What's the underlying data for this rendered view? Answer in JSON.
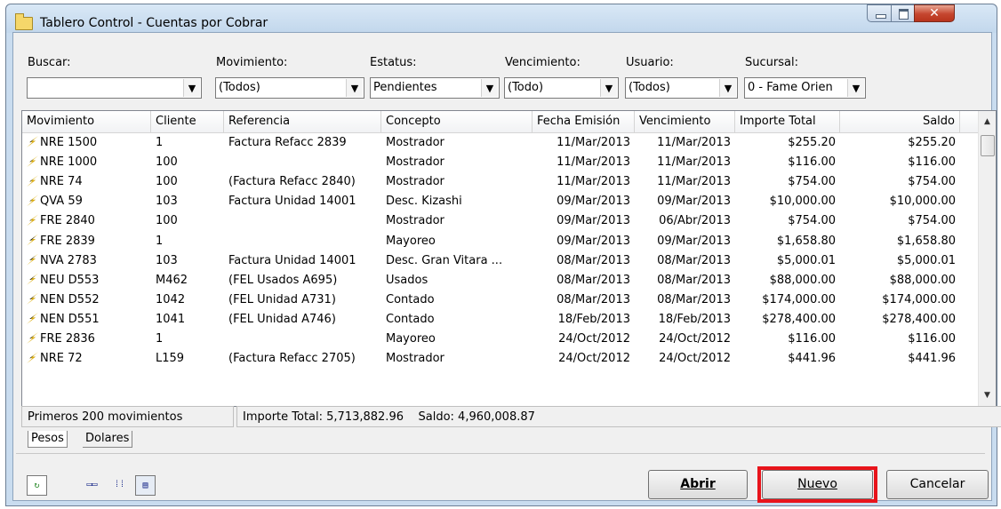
{
  "window": {
    "title": "Tablero Control - Cuentas por Cobrar"
  },
  "filters": {
    "buscar": {
      "label": "Buscar:",
      "value": ""
    },
    "movimiento": {
      "label": "Movimiento:",
      "value": "(Todos)"
    },
    "estatus": {
      "label": "Estatus:",
      "value": "Pendientes"
    },
    "vencimiento": {
      "label": "Vencimiento:",
      "value": "(Todo)"
    },
    "usuario": {
      "label": "Usuario:",
      "value": "(Todos)"
    },
    "sucursal": {
      "label": "Sucursal:",
      "value": "0 - Fame Orien"
    }
  },
  "grid": {
    "columns": [
      "Movimiento",
      "Cliente",
      "Referencia",
      "Concepto",
      "Fecha Emisión",
      "Vencimiento",
      "Importe Total",
      "Saldo"
    ],
    "rows": [
      [
        "NRE 1500",
        "1",
        "Factura Refacc 2839",
        "Mostrador",
        "11/Mar/2013",
        "11/Mar/2013",
        "$255.20",
        "$255.20"
      ],
      [
        "NRE 1000",
        "100",
        "",
        "Mostrador",
        "11/Mar/2013",
        "11/Mar/2013",
        "$116.00",
        "$116.00"
      ],
      [
        "NRE 74",
        "100",
        "(Factura Refacc 2840)",
        "Mostrador",
        "11/Mar/2013",
        "11/Mar/2013",
        "$754.00",
        "$754.00"
      ],
      [
        "QVA 59",
        "103",
        "Factura Unidad 14001",
        "Desc. Kizashi",
        "09/Mar/2013",
        "09/Mar/2013",
        "$10,000.00",
        "$10,000.00"
      ],
      [
        "FRE 2840",
        "100",
        "",
        "Mostrador",
        "09/Mar/2013",
        "06/Abr/2013",
        "$754.00",
        "$754.00"
      ],
      [
        "FRE 2839",
        "1",
        "",
        "Mayoreo",
        "09/Mar/2013",
        "09/Mar/2013",
        "$1,658.80",
        "$1,658.80"
      ],
      [
        "NVA 2783",
        "103",
        "Factura Unidad 14001",
        "Desc. Gran Vitara ...",
        "08/Mar/2013",
        "08/Mar/2013",
        "$5,000.01",
        "$5,000.01"
      ],
      [
        "NEU D553",
        "M462",
        "(FEL Usados A695)",
        "Usados",
        "08/Mar/2013",
        "08/Mar/2013",
        "$88,000.00",
        "$88,000.00"
      ],
      [
        "NEN D552",
        "1042",
        "(FEL Unidad A731)",
        "Contado",
        "08/Mar/2013",
        "08/Mar/2013",
        "$174,000.00",
        "$174,000.00"
      ],
      [
        "NEN D551",
        "1041",
        "(FEL Unidad A746)",
        "Contado",
        "18/Feb/2013",
        "18/Feb/2013",
        "$278,400.00",
        "$278,400.00"
      ],
      [
        "FRE 2836",
        "1",
        "",
        "Mayoreo",
        "24/Oct/2012",
        "24/Oct/2012",
        "$116.00",
        "$116.00"
      ],
      [
        "NRE 72",
        "L159",
        "(Factura Refacc 2705)",
        "Mostrador",
        "24/Oct/2012",
        "24/Oct/2012",
        "$441.96",
        "$441.96"
      ]
    ]
  },
  "status": {
    "count": "Primeros 200 movimientos",
    "totals": "Importe Total: 5,713,882.96    Saldo: 4,960,008.87"
  },
  "tabs": [
    "Pesos",
    "Dolares"
  ],
  "toolbar_icons": [
    "refresh-icon",
    "small-icons-view-icon",
    "list-view-icon",
    "details-view-icon"
  ],
  "buttons": {
    "abrir": "Abrir",
    "nuevo": "Nuevo",
    "cancelar": "Cancelar"
  },
  "colors": {
    "highlight": "#e8141b",
    "title_bar": "#c9dcef",
    "close_button": "#c5452e"
  }
}
